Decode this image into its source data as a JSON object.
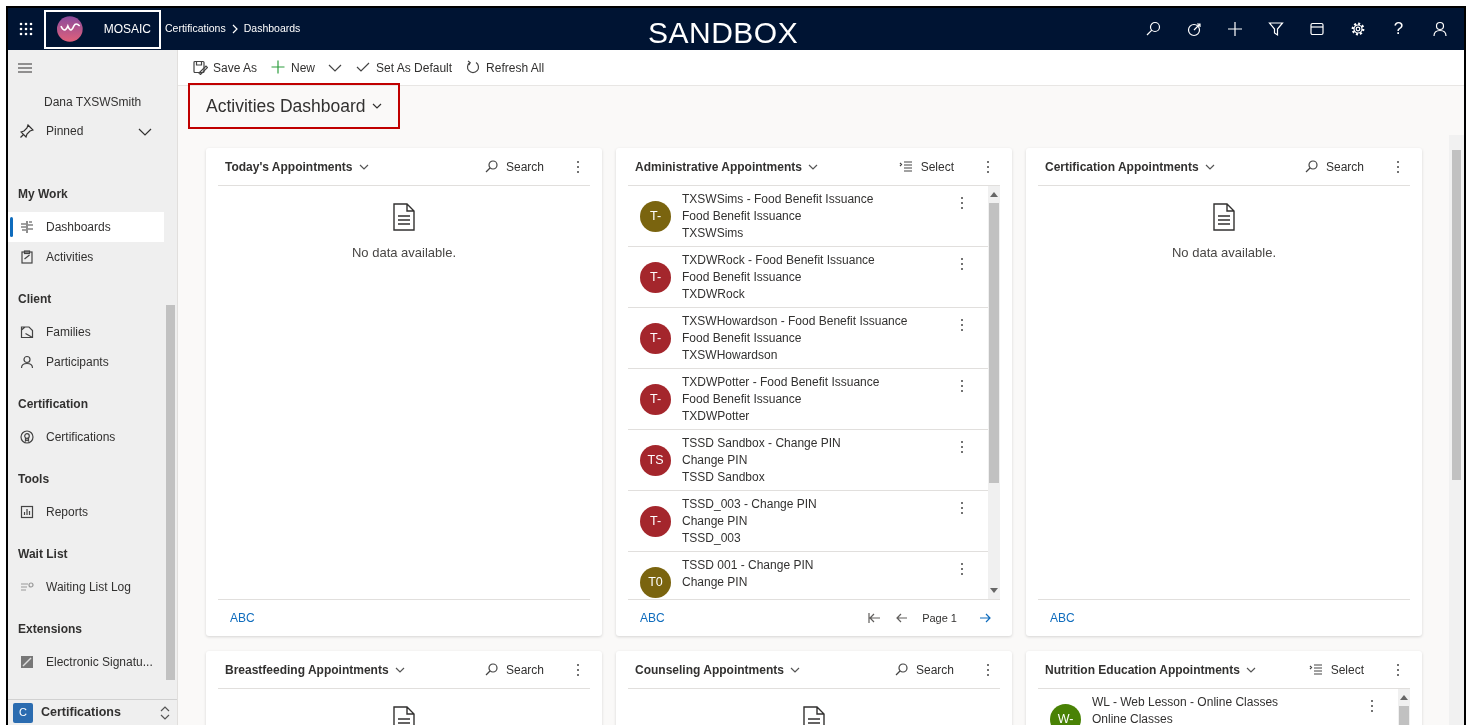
{
  "header": {
    "app_name": "MOSAIC",
    "breadcrumb": [
      "Certifications",
      "Dashboards"
    ],
    "environment": "SANDBOX",
    "help": "?"
  },
  "toolbar": [
    {
      "label": "Save As",
      "has_menu": false
    },
    {
      "label": "New",
      "has_menu": true
    },
    {
      "label": "Set As Default",
      "has_menu": false
    },
    {
      "label": "Refresh All",
      "has_menu": false
    }
  ],
  "sidebar": {
    "user": "Dana TXSWSmith",
    "pinned": {
      "label": "Pinned",
      "expanded": false
    },
    "groups": [
      {
        "title": "My Work",
        "items": [
          {
            "label": "Dashboards",
            "selected": true
          },
          {
            "label": "Activities",
            "selected": false
          }
        ]
      },
      {
        "title": "Client",
        "items": [
          {
            "label": "Families",
            "selected": false
          },
          {
            "label": "Participants",
            "selected": false
          }
        ]
      },
      {
        "title": "Certification",
        "items": [
          {
            "label": "Certifications",
            "selected": false
          }
        ]
      },
      {
        "title": "Tools",
        "items": [
          {
            "label": "Reports",
            "selected": false
          }
        ]
      },
      {
        "title": "Wait List",
        "items": [
          {
            "label": "Waiting List Log",
            "selected": false
          }
        ]
      },
      {
        "title": "Extensions",
        "items": [
          {
            "label": "Electronic Signatu...",
            "selected": false
          }
        ]
      }
    ],
    "area": {
      "badge": "C",
      "label": "Certifications"
    }
  },
  "dashboard": {
    "title": "Activities Dashboard",
    "highlighted": true,
    "cards": [
      {
        "title": "Today's Appointments",
        "action": {
          "kind": "search",
          "label": "Search"
        },
        "kind": "empty",
        "empty_text": "No data available.",
        "footer": "ABC"
      },
      {
        "title": "Administrative Appointments",
        "action": {
          "kind": "select",
          "label": "Select"
        },
        "kind": "list",
        "footer": "ABC",
        "items": [
          {
            "avatar": "T-",
            "color": "#7a640f",
            "lines": [
              "TXSWSims - Food Benefit Issuance",
              "Food Benefit Issuance",
              "TXSWSims"
            ]
          },
          {
            "avatar": "T-",
            "color": "#a4262c",
            "lines": [
              "TXDWRock - Food Benefit Issuance",
              "Food Benefit Issuance",
              "TXDWRock"
            ]
          },
          {
            "avatar": "T-",
            "color": "#a4262c",
            "lines": [
              "TXSWHowardson - Food Benefit Issuance",
              "Food Benefit Issuance",
              "TXSWHowardson"
            ]
          },
          {
            "avatar": "T-",
            "color": "#a4262c",
            "lines": [
              "TXDWPotter - Food Benefit Issuance",
              "Food Benefit Issuance",
              "TXDWPotter"
            ]
          },
          {
            "avatar": "TS",
            "color": "#a4262c",
            "lines": [
              "TSSD Sandbox - Change PIN",
              "Change PIN",
              "TSSD Sandbox"
            ]
          },
          {
            "avatar": "T-",
            "color": "#a4262c",
            "lines": [
              "TSSD_003 - Change PIN",
              "Change PIN",
              "TSSD_003"
            ]
          },
          {
            "avatar": "T0",
            "color": "#7a640f",
            "lines": [
              "TSSD 001 - Change PIN",
              "Change PIN"
            ]
          }
        ],
        "pager": {
          "label": "Page 1",
          "first_enabled": false,
          "previous_enabled": false,
          "next_enabled": true
        }
      },
      {
        "title": "Certification Appointments",
        "action": {
          "kind": "search",
          "label": "Search"
        },
        "kind": "empty",
        "empty_text": "No data available.",
        "footer": "ABC"
      },
      {
        "title": "Breastfeeding Appointments",
        "action": {
          "kind": "search",
          "label": "Search"
        },
        "kind": "empty"
      },
      {
        "title": "Counseling Appointments",
        "action": {
          "kind": "search",
          "label": "Search"
        },
        "kind": "empty"
      },
      {
        "title": "Nutrition Education Appointments",
        "action": {
          "kind": "select",
          "label": "Select"
        },
        "kind": "list",
        "items": [
          {
            "avatar": "W-",
            "color": "#498205",
            "lines": [
              "WL - Web Lesson - Online Classes",
              "Online Classes"
            ]
          }
        ]
      }
    ]
  }
}
